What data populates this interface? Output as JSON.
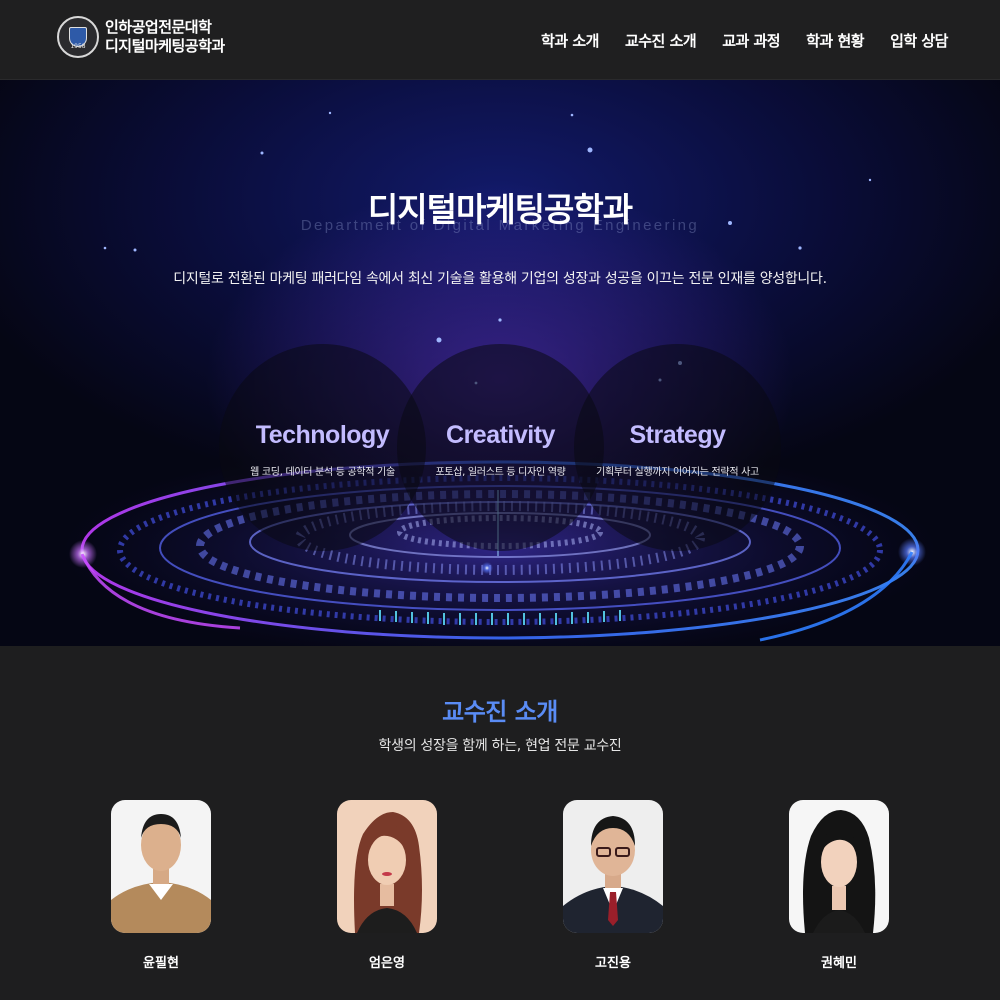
{
  "header": {
    "logo_line1": "인하공업전문대학",
    "logo_line2": "디지털마케팅공학과",
    "seal_year": "1958",
    "nav": [
      "학과 소개",
      "교수진 소개",
      "교과 과정",
      "학과 현황",
      "입학 상담"
    ]
  },
  "hero": {
    "title": "디지털마케팅공학과",
    "subtitle": "Department of Digital Marketing Engineering",
    "description": "디지털로 전환된 마케팅 패러다임 속에서 최신 기술을 활용해 기업의 성장과 성공을 이끄는 전문 인재를 양성합니다.",
    "pillars": [
      {
        "title": "Technology",
        "desc": "웹 코딩, 데이터 분석 등 공학적 기술"
      },
      {
        "title": "Creativity",
        "desc": "포토샵, 일러스트 등 디자인 역량"
      },
      {
        "title": "Strategy",
        "desc": "기획부터 실행까지 이어지는 전략적 사고"
      }
    ]
  },
  "faculty": {
    "title": "교수진 소개",
    "subtitle": "학생의 성장을 함께 하는, 현업 전문 교수진",
    "members": [
      {
        "name": "윤필현"
      },
      {
        "name": "엄은영"
      },
      {
        "name": "고진용"
      },
      {
        "name": "권혜민"
      }
    ]
  },
  "colors": {
    "accent": "#5a8cf5",
    "pillar_title": "#c3bcff",
    "background": "#1e1e1f"
  }
}
